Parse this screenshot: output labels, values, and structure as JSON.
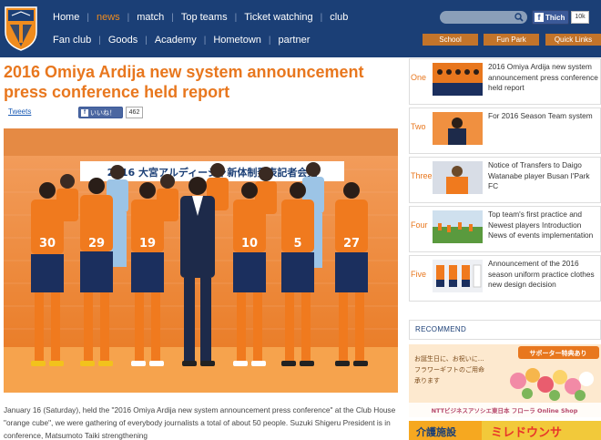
{
  "nav": {
    "row1": [
      "Home",
      "news",
      "match",
      "Top teams",
      "Ticket watching",
      "club"
    ],
    "row2": [
      "Fan club",
      "Goods",
      "Academy",
      "Hometown",
      "partner"
    ],
    "active": "news"
  },
  "header": {
    "fb_label": "Thich",
    "fb_count": "10k",
    "sub_buttons": [
      "School",
      "Fun Park",
      "Quick Links"
    ]
  },
  "article": {
    "title": "2016 Omiya Ardija new system announcement press conference held report",
    "tweets_label": "Tweets",
    "like_label": "いいね！",
    "like_count": "462",
    "photo_banner": "2016 大宮アルディージャ新体制発表記者会見",
    "jersey_numbers": [
      "30",
      "29",
      "19",
      "10",
      "5",
      "27"
    ],
    "body": "January 16 (Saturday), held the \"2016 Omiya Ardija new system announcement press conference\" at the Club House \"orange cube\", we were gathering of everybody journalists a total of about 50 people.   Suzuki Shigeru President is in conference, Matsumoto Taiki strengthening"
  },
  "sidebar": {
    "items": [
      {
        "num": "One",
        "text": "2016 Omiya Ardija new system announcement press conference held report"
      },
      {
        "num": "Two",
        "text": "For 2016 Season Team system"
      },
      {
        "num": "Three",
        "text": "Notice of Transfers to Daigo Watanabe player Busan I'Park FC"
      },
      {
        "num": "Four",
        "text": "Top team's first practice and Newest players Introduction News of events implementation"
      },
      {
        "num": "Five",
        "text": "Announcement of the 2016 season uniform practice clothes new design decision"
      }
    ],
    "recommend_label": "RECOMMEND",
    "banner1": {
      "top": "サポーター特典あり",
      "left1": "お誕生日に、お祝いに…",
      "left2": "フラワーギフトのご用命",
      "left3": "承ります",
      "bottom": "NTTビジネスアソシエ東日本 フローラ Online Shop"
    },
    "banner2": {
      "left": "介護施設",
      "right": "ミレドウンサ"
    }
  },
  "colors": {
    "navy": "#1b3f76",
    "orange": "#e8771e",
    "sub_button": "#c3742a"
  }
}
